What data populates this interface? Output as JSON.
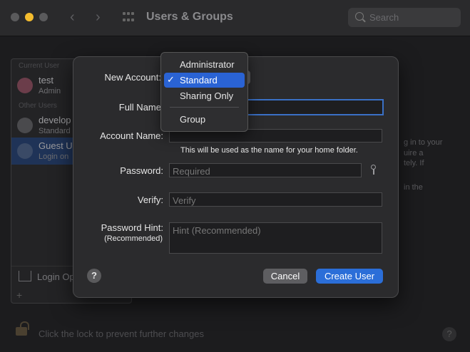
{
  "window": {
    "title": "Users & Groups",
    "search_placeholder": "Search"
  },
  "user_list": {
    "current_user_header": "Current User",
    "other_users_header": "Other Users",
    "users": [
      {
        "name": "test",
        "role": "Admin"
      },
      {
        "name": "develop",
        "role": "Standard"
      },
      {
        "name": "Guest U",
        "role": "Login on"
      }
    ],
    "login_options": "Login Op",
    "add_label": "+"
  },
  "right_panel_text": [
    "g in to your",
    "uire a",
    "tely. If",
    "in the"
  ],
  "lock_text": "Click the lock to prevent further changes",
  "sheet": {
    "new_account_label": "New Account:",
    "full_name_label": "Full Name",
    "account_name_label": "Account Name:",
    "account_name_note": "This will be used as the name for your home folder.",
    "password_label": "Password:",
    "password_placeholder": "Required",
    "verify_label": "Verify:",
    "verify_placeholder": "Verify",
    "hint_label": "Password Hint:",
    "hint_sub_label": "(Recommended)",
    "hint_placeholder": "Hint (Recommended)",
    "help_label": "?",
    "cancel_label": "Cancel",
    "create_label": "Create User"
  },
  "account_type_menu": {
    "items": [
      "Administrator",
      "Standard",
      "Sharing Only",
      "Group"
    ],
    "selected": "Standard",
    "check": "✓"
  },
  "colors": {
    "accent": "#2b6ed8",
    "focus": "#3a70c6",
    "sheet_bg": "#2b2b2d"
  }
}
